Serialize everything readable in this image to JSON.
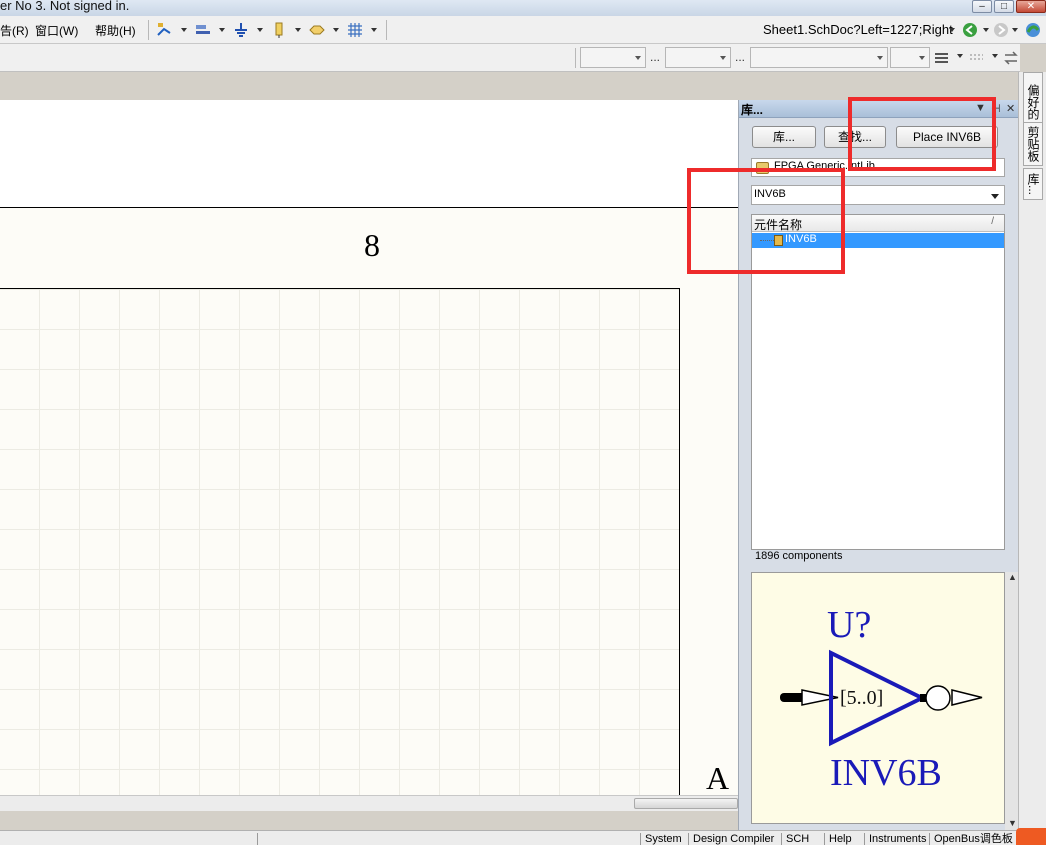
{
  "title_bar": {
    "text": "er No 3. Not signed in."
  },
  "menu": {
    "items": [
      {
        "label": "告(R)"
      },
      {
        "label": "窗口(W)"
      },
      {
        "label": "帮助(H)"
      }
    ]
  },
  "toolbar": {
    "doc_path": "Sheet1.SchDoc?Left=1227;Right"
  },
  "schematic": {
    "zone_number": "8",
    "zone_letter": "A"
  },
  "library_panel": {
    "title": "库...",
    "buttons": {
      "libraries": "库...",
      "search": "查找...",
      "place": "Place INV6B"
    },
    "library_selected": "FPGA Generic.IntLib",
    "filter_value": "INV6B",
    "column_header": "元件名称",
    "sort_indicator": "/",
    "components": [
      {
        "name": "INV6B",
        "selected": true
      }
    ],
    "component_count": "1896 components",
    "preview": {
      "designator": "U?",
      "pin_label": "[5..0]",
      "part_name": "INV6B"
    }
  },
  "side_tabs": [
    "偏好的",
    "剪贴板",
    "库..."
  ],
  "status_tabs": [
    "System",
    "Design Compiler",
    "SCH",
    "Help",
    "Instruments",
    "OpenBus调色板"
  ],
  "colors": {
    "highlight_red": "#ee2b2b",
    "selection_blue": "#3399ff",
    "symbol_blue": "#1a1ab8",
    "preview_bg": "#fefce6"
  }
}
